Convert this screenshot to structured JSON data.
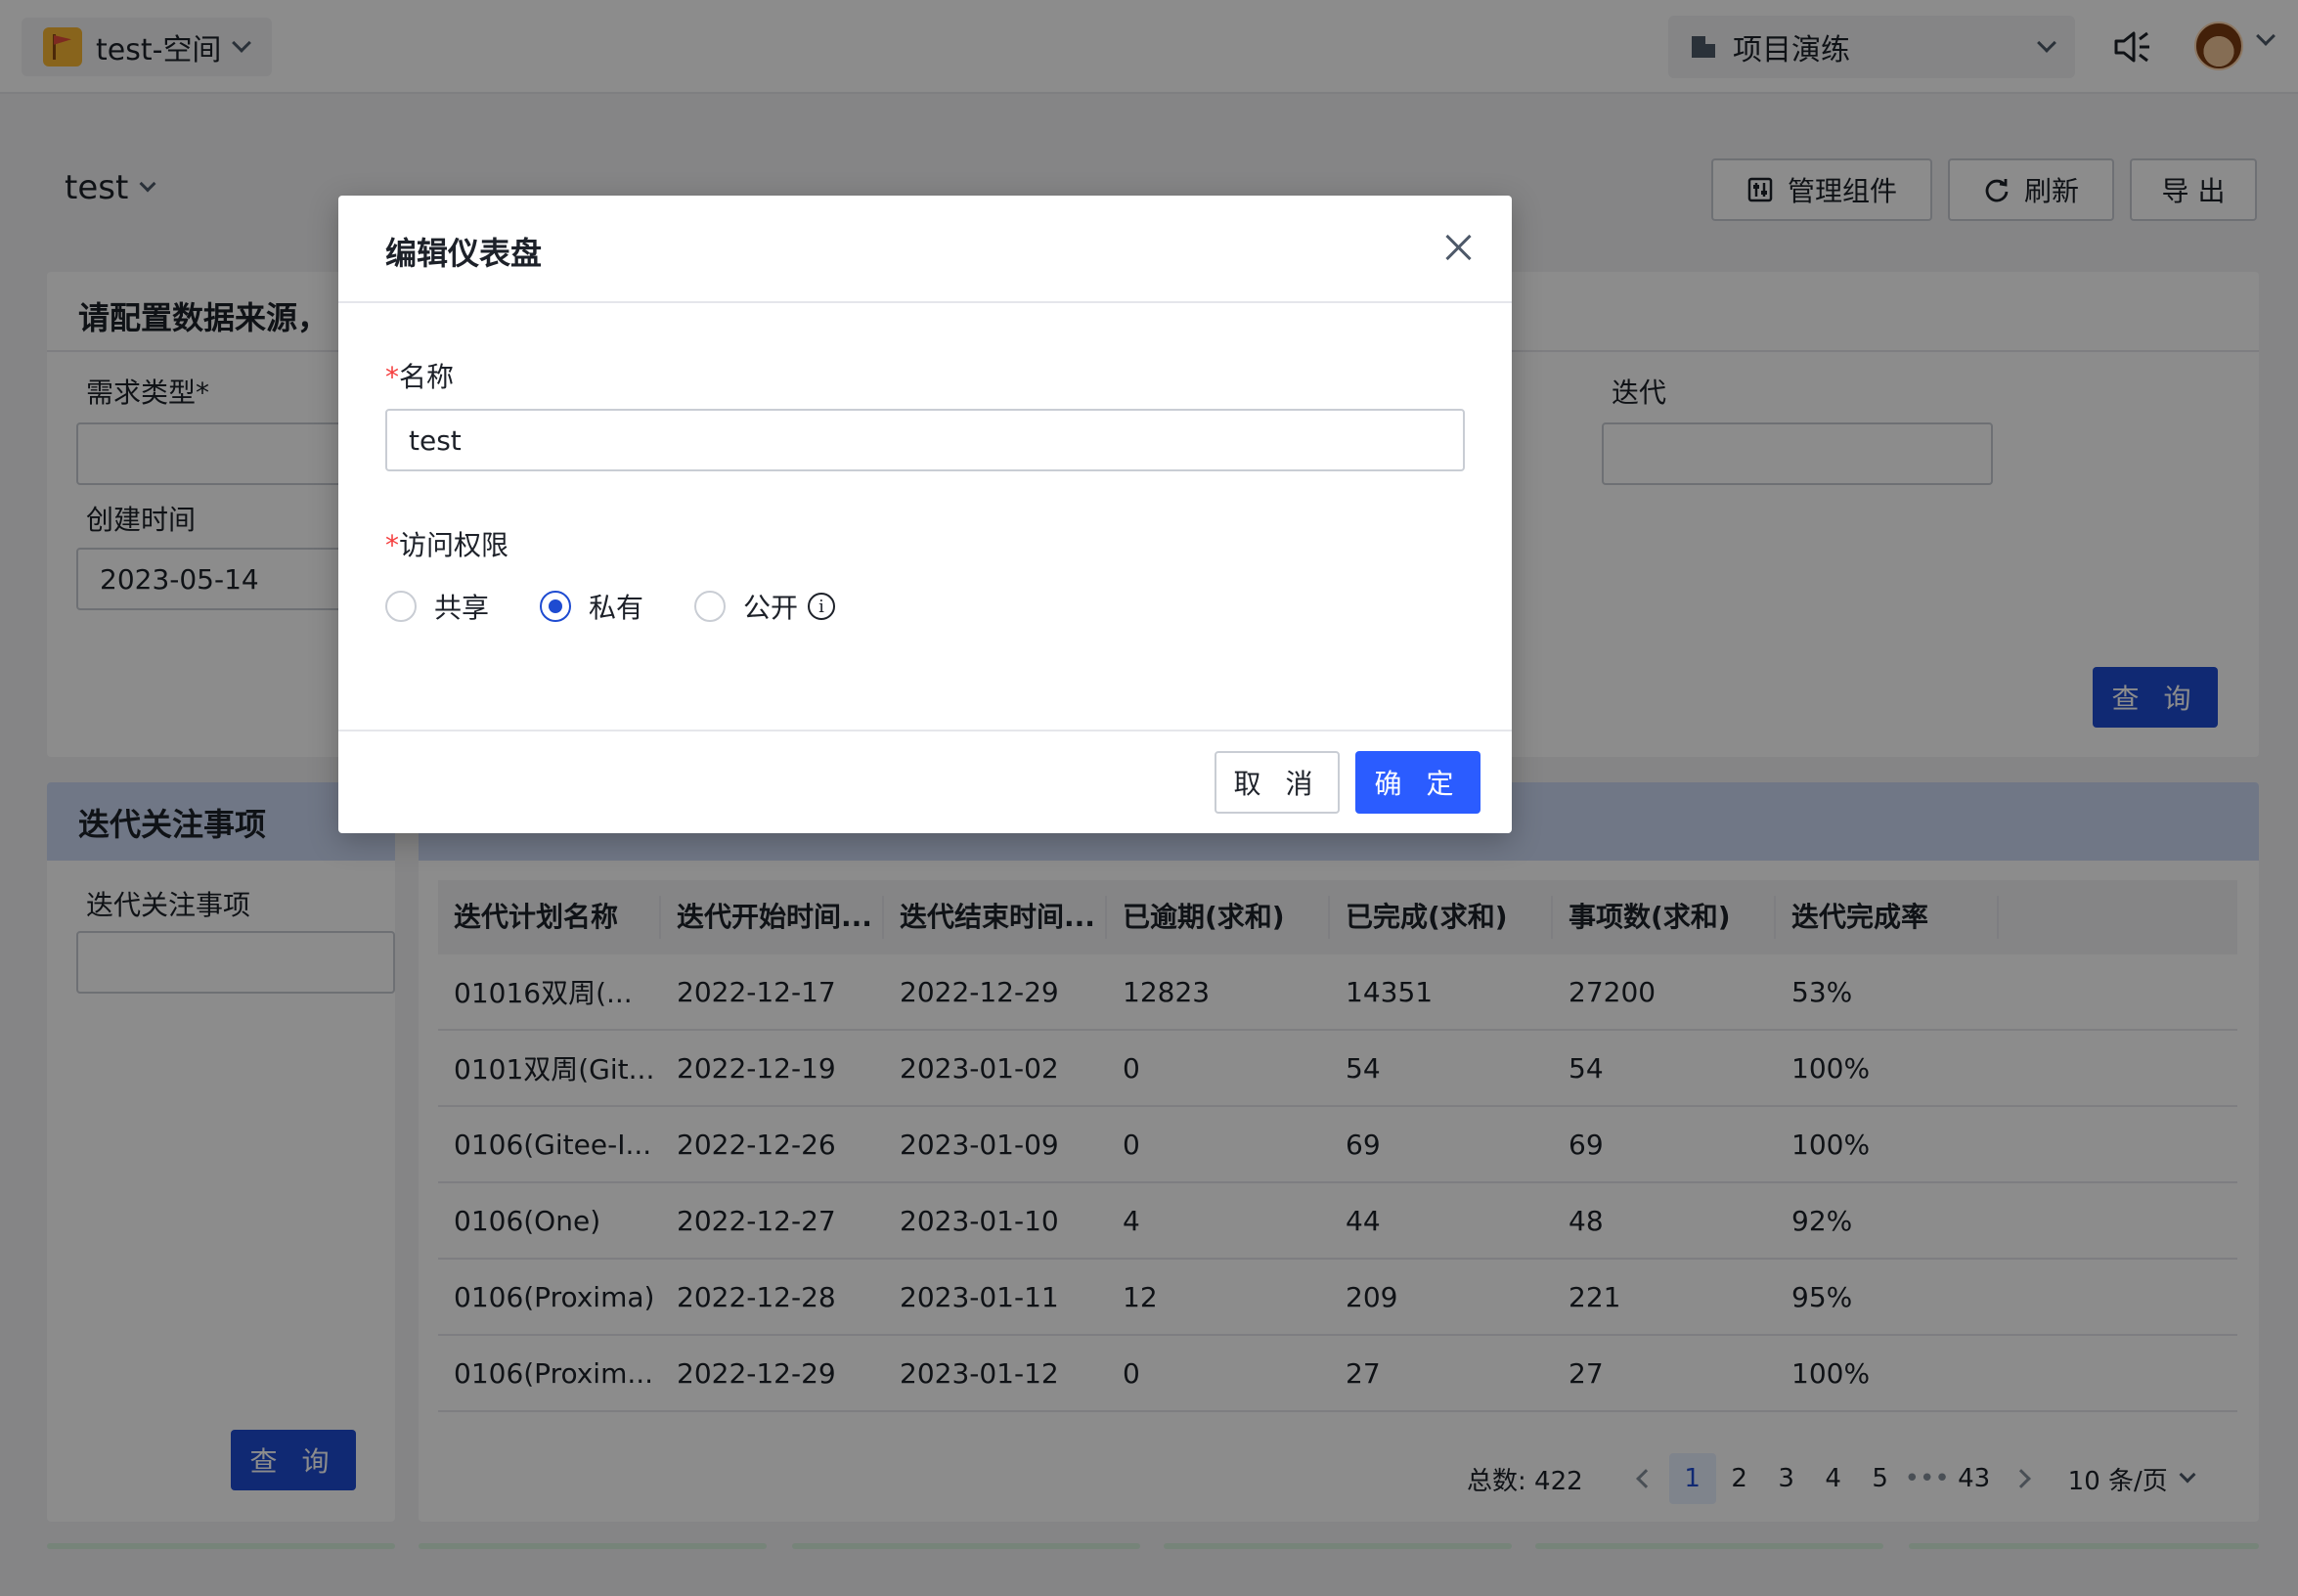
{
  "topbar": {
    "space_name": "test-空间",
    "project_name": "项目演练"
  },
  "dashboard": {
    "title": "test",
    "buttons": {
      "manage": "管理组件",
      "refresh": "刷新",
      "export": "导 出"
    }
  },
  "filter_card": {
    "title": "请配置数据来源，",
    "demand_type_label": "需求类型*",
    "iteration_label": "迭代",
    "created_time_label": "创建时间",
    "created_time_value": "2023-05-14",
    "query_button": "查 询"
  },
  "left_card": {
    "title": "迭代关注事项",
    "field_label": "迭代关注事项",
    "query_button": "查 询"
  },
  "table": {
    "columns": [
      "迭代计划名称",
      "迭代开始时间...",
      "迭代结束时间...",
      "已逾期(求和)",
      "已完成(求和)",
      "事项数(求和)",
      "迭代完成率"
    ],
    "rows": [
      [
        "01016双周(...",
        "2022-12-17",
        "2022-12-29",
        "12823",
        "14351",
        "27200",
        "53%"
      ],
      [
        "0101双周(Git...",
        "2022-12-19",
        "2023-01-02",
        "0",
        "54",
        "54",
        "100%"
      ],
      [
        "0106(Gitee-I...",
        "2022-12-26",
        "2023-01-09",
        "0",
        "69",
        "69",
        "100%"
      ],
      [
        "0106(One)",
        "2022-12-27",
        "2023-01-10",
        "4",
        "44",
        "48",
        "92%"
      ],
      [
        "0106(Proxima)",
        "2022-12-28",
        "2023-01-11",
        "12",
        "209",
        "221",
        "95%"
      ],
      [
        "0106(Proxim...",
        "2022-12-29",
        "2023-01-12",
        "0",
        "27",
        "27",
        "100%"
      ]
    ]
  },
  "pagination": {
    "total": "总数: 422",
    "pages": [
      "1",
      "2",
      "3",
      "4",
      "5"
    ],
    "ellipsis": "•••",
    "last_page": "43",
    "page_size": "10 条/页"
  },
  "modal": {
    "title": "编辑仪表盘",
    "name_label": "名称",
    "name_value": "test",
    "access_label": "访问权限",
    "required_mark": "*",
    "options": [
      "共享",
      "私有",
      "公开"
    ],
    "selected_option": "私有",
    "cancel": "取 消",
    "ok": "确 定"
  },
  "colors": {
    "primary": "#2b5cff",
    "primary_dark": "#1e4bd1",
    "required": "#f53f3f",
    "card_header": "#cdd9f5"
  }
}
